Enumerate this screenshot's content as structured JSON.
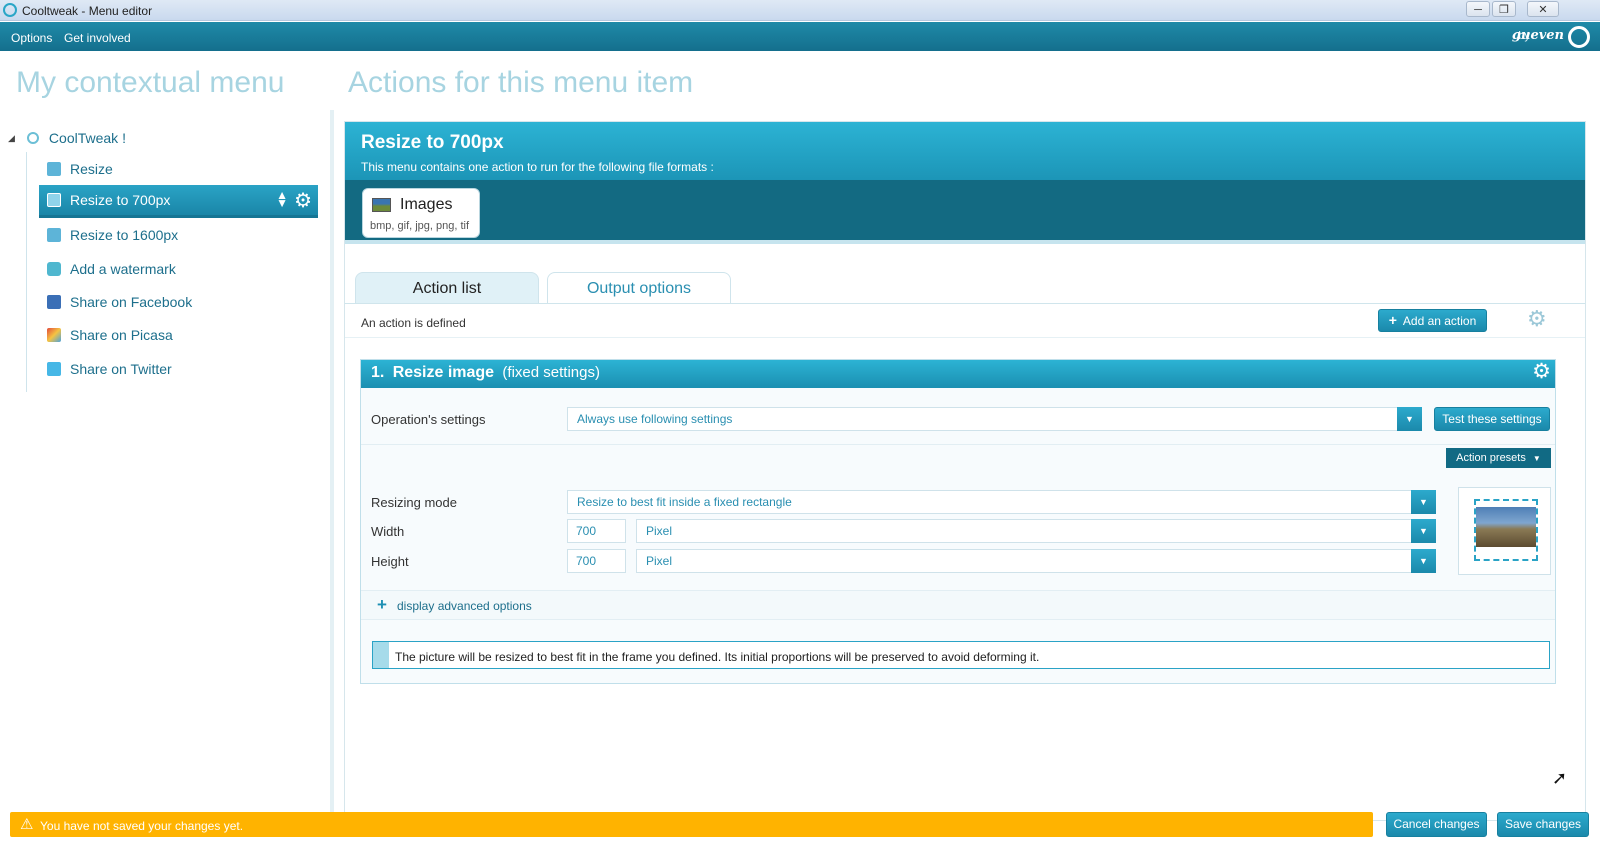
{
  "window": {
    "title": "Cooltweak - Menu editor",
    "minimize": "─",
    "maximize": "❐",
    "close": "✕"
  },
  "menubar": {
    "items": [
      "Options",
      "Get involved"
    ],
    "by": "by",
    "brand": "gueven"
  },
  "left": {
    "heading": "My contextual menu",
    "root": "CoolTweak !",
    "items": [
      {
        "label": "Resize",
        "icon": "resize-icon"
      },
      {
        "label": "Resize to 700px",
        "icon": "resize-icon",
        "selected": true
      },
      {
        "label": "Resize to 1600px",
        "icon": "resize-icon"
      },
      {
        "label": "Add a watermark",
        "icon": "watermark-icon"
      },
      {
        "label": "Share on Facebook",
        "icon": "facebook-icon"
      },
      {
        "label": "Share on Picasa",
        "icon": "picasa-icon"
      },
      {
        "label": "Share on Twitter",
        "icon": "twitter-icon"
      }
    ]
  },
  "right": {
    "heading": "Actions for this menu item",
    "format": {
      "title": "Resize to 700px",
      "subtitle": "This menu contains one action to run for the following file formats :",
      "card_name": "Images",
      "card_ext": "bmp, gif, jpg, png, tif"
    },
    "tabs": [
      "Action list",
      "Output options"
    ],
    "status": "An action is defined",
    "add_action": "Add an action",
    "action": {
      "number": "1.",
      "name": "Resize image",
      "suffix": "(fixed settings)",
      "op_label": "Operation's settings",
      "op_value": "Always use following settings",
      "test_button": "Test these settings",
      "presets": "Action presets",
      "mode_label": "Resizing mode",
      "mode_value": "Resize to best fit inside a fixed rectangle",
      "width_label": "Width",
      "width_value": "700",
      "width_unit": "Pixel",
      "height_label": "Height",
      "height_value": "700",
      "height_unit": "Pixel",
      "advanced": "display advanced options",
      "info": "The picture will be resized to best fit in the frame you defined. Its initial proportions will be preserved to avoid deforming it."
    }
  },
  "footer": {
    "warning": "You have not saved your changes yet.",
    "cancel": "Cancel changes",
    "save": "Save changes"
  },
  "colors": {
    "accent": "#1f8aa8",
    "heading": "#a7d4e1",
    "warning": "#ffb300"
  }
}
